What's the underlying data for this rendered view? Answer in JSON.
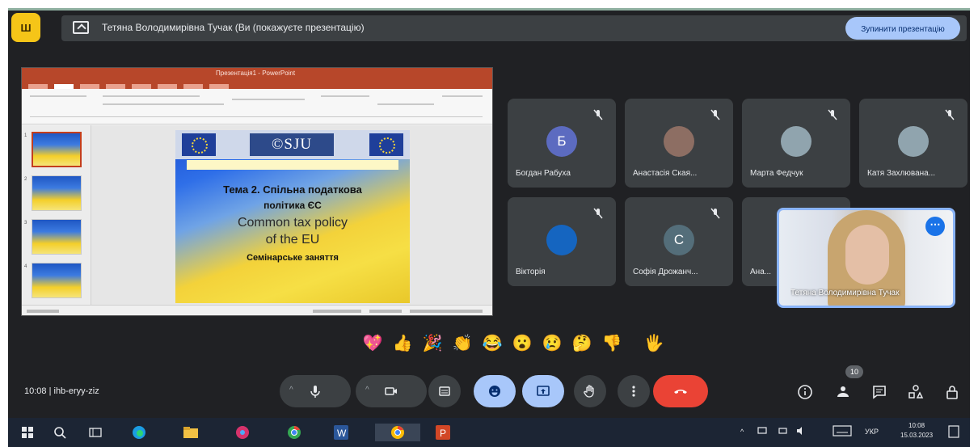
{
  "meeting": {
    "app_badge": "Ш",
    "presenting_text": "Тетяна Володимирівна Тучак (Ви (покажуєте презентацію)",
    "stop_presenting_label": "Зупинити презентацію",
    "info": "10:08  |  ihb-eryy-ziz"
  },
  "shared_screen": {
    "ppt_title": "Презентація1 - PowerPoint",
    "slide": {
      "logo": "©SJU",
      "title_line1": "Тема 2. Спільна податкова",
      "title_line2": "політика ЄС",
      "en_line1": "Common tax policy",
      "en_line2": "of the EU",
      "subtitle": "Семінарське заняття"
    },
    "thumbs": [
      "1",
      "2",
      "3",
      "4"
    ]
  },
  "participants": [
    {
      "name": "Богдан Рабуха",
      "initial": "Б",
      "avatar_color": "#5c6bc0"
    },
    {
      "name": "Анастасія Ская...",
      "initial": "",
      "avatar_color": "#8d6e63"
    },
    {
      "name": "Марта Федчук",
      "initial": "",
      "avatar_color": "#90a4ae"
    },
    {
      "name": "Катя Захлювана...",
      "initial": "",
      "avatar_color": "#90a4ae"
    },
    {
      "name": "Вікторія",
      "initial": "",
      "avatar_color": "#1565c0"
    },
    {
      "name": "Софія Дрожанч...",
      "initial": "С",
      "avatar_color": "#546e7a"
    },
    {
      "name": "Ана...",
      "initial": "",
      "avatar_color": "#3c4043"
    }
  ],
  "self_view": {
    "name": "Тетяна Володимирівна Тучак"
  },
  "reactions": [
    "💖",
    "👍",
    "🎉",
    "👏",
    "😂",
    "😮",
    "😢",
    "🤔",
    "👎",
    "🖐"
  ],
  "controls": {
    "participants_count": "10"
  },
  "taskbar": {
    "tray_lang": "УКР",
    "time": "10:08",
    "date": "15.03.2023"
  },
  "colors": {
    "meet_bg": "#202124",
    "tile_bg": "#3c4043",
    "accent_blue": "#a8c7fa",
    "end_call_red": "#ea4335",
    "ppt_red": "#b7472a"
  }
}
